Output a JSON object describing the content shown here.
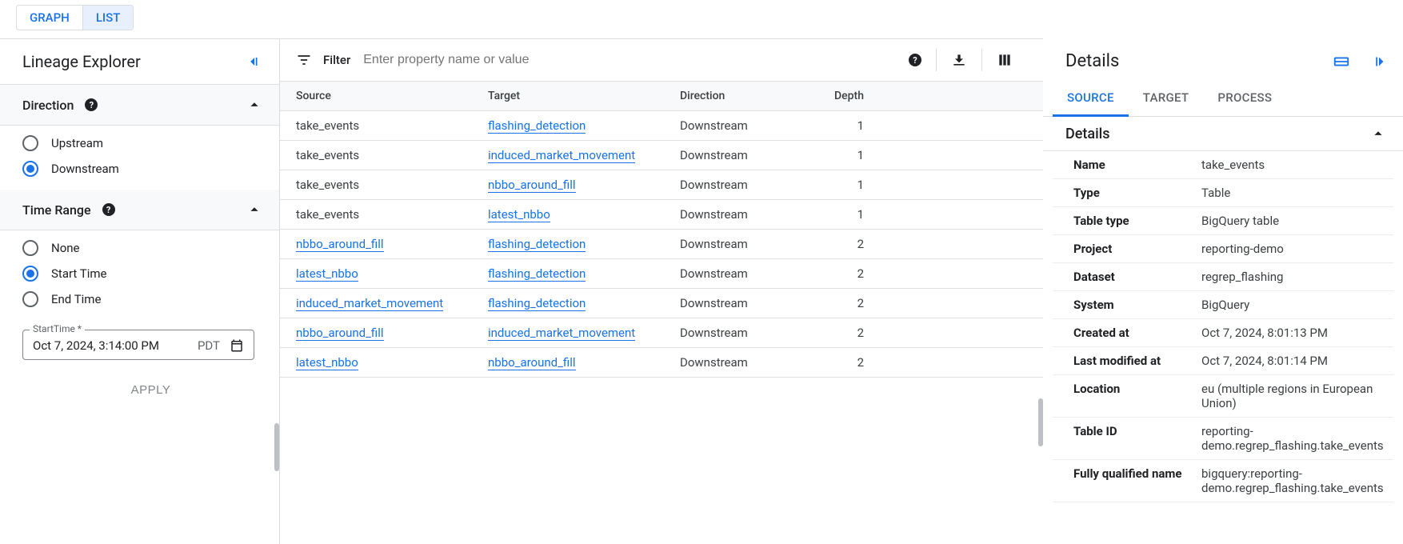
{
  "view_tabs": {
    "graph": "GRAPH",
    "list": "LIST"
  },
  "left": {
    "title": "Lineage Explorer",
    "direction_label": "Direction",
    "direction_upstream": "Upstream",
    "direction_downstream": "Downstream",
    "timerange_label": "Time Range",
    "timerange_none": "None",
    "timerange_start": "Start Time",
    "timerange_end": "End Time",
    "starttime_floating": "StartTime *",
    "starttime_value": "Oct 7, 2024, 3:14:00 PM",
    "starttime_tz": "PDT",
    "apply": "APPLY"
  },
  "filter": {
    "label": "Filter",
    "placeholder": "Enter property name or value"
  },
  "table": {
    "headers": {
      "source": "Source",
      "target": "Target",
      "direction": "Direction",
      "depth": "Depth"
    },
    "rows": [
      {
        "source": "take_events",
        "source_link": false,
        "target": "flashing_detection",
        "direction": "Downstream",
        "depth": "1"
      },
      {
        "source": "take_events",
        "source_link": false,
        "target": "induced_market_movement",
        "direction": "Downstream",
        "depth": "1"
      },
      {
        "source": "take_events",
        "source_link": false,
        "target": "nbbo_around_fill",
        "direction": "Downstream",
        "depth": "1"
      },
      {
        "source": "take_events",
        "source_link": false,
        "target": "latest_nbbo",
        "direction": "Downstream",
        "depth": "1"
      },
      {
        "source": "nbbo_around_fill",
        "source_link": true,
        "target": "flashing_detection",
        "direction": "Downstream",
        "depth": "2"
      },
      {
        "source": "latest_nbbo",
        "source_link": true,
        "target": "flashing_detection",
        "direction": "Downstream",
        "depth": "2"
      },
      {
        "source": "induced_market_movement",
        "source_link": true,
        "target": "flashing_detection",
        "direction": "Downstream",
        "depth": "2"
      },
      {
        "source": "nbbo_around_fill",
        "source_link": true,
        "target": "induced_market_movement",
        "direction": "Downstream",
        "depth": "2"
      },
      {
        "source": "latest_nbbo",
        "source_link": true,
        "target": "nbbo_around_fill",
        "direction": "Downstream",
        "depth": "2"
      }
    ]
  },
  "details": {
    "title": "Details",
    "tabs": {
      "source": "SOURCE",
      "target": "TARGET",
      "process": "PROCESS"
    },
    "sub_title": "Details",
    "props": [
      {
        "k": "Name",
        "v": "take_events"
      },
      {
        "k": "Type",
        "v": "Table"
      },
      {
        "k": "Table type",
        "v": "BigQuery table"
      },
      {
        "k": "Project",
        "v": "reporting-demo"
      },
      {
        "k": "Dataset",
        "v": "regrep_flashing"
      },
      {
        "k": "System",
        "v": "BigQuery"
      },
      {
        "k": "Created at",
        "v": "Oct 7, 2024, 8:01:13 PM"
      },
      {
        "k": "Last modified at",
        "v": "Oct 7, 2024, 8:01:14 PM"
      },
      {
        "k": "Location",
        "v": "eu (multiple regions in European Union)"
      },
      {
        "k": "Table ID",
        "v": "reporting-demo.regrep_flashing.take_events"
      },
      {
        "k": "Fully qualified name",
        "v": "bigquery:reporting-demo.regrep_flashing.take_events"
      }
    ]
  }
}
